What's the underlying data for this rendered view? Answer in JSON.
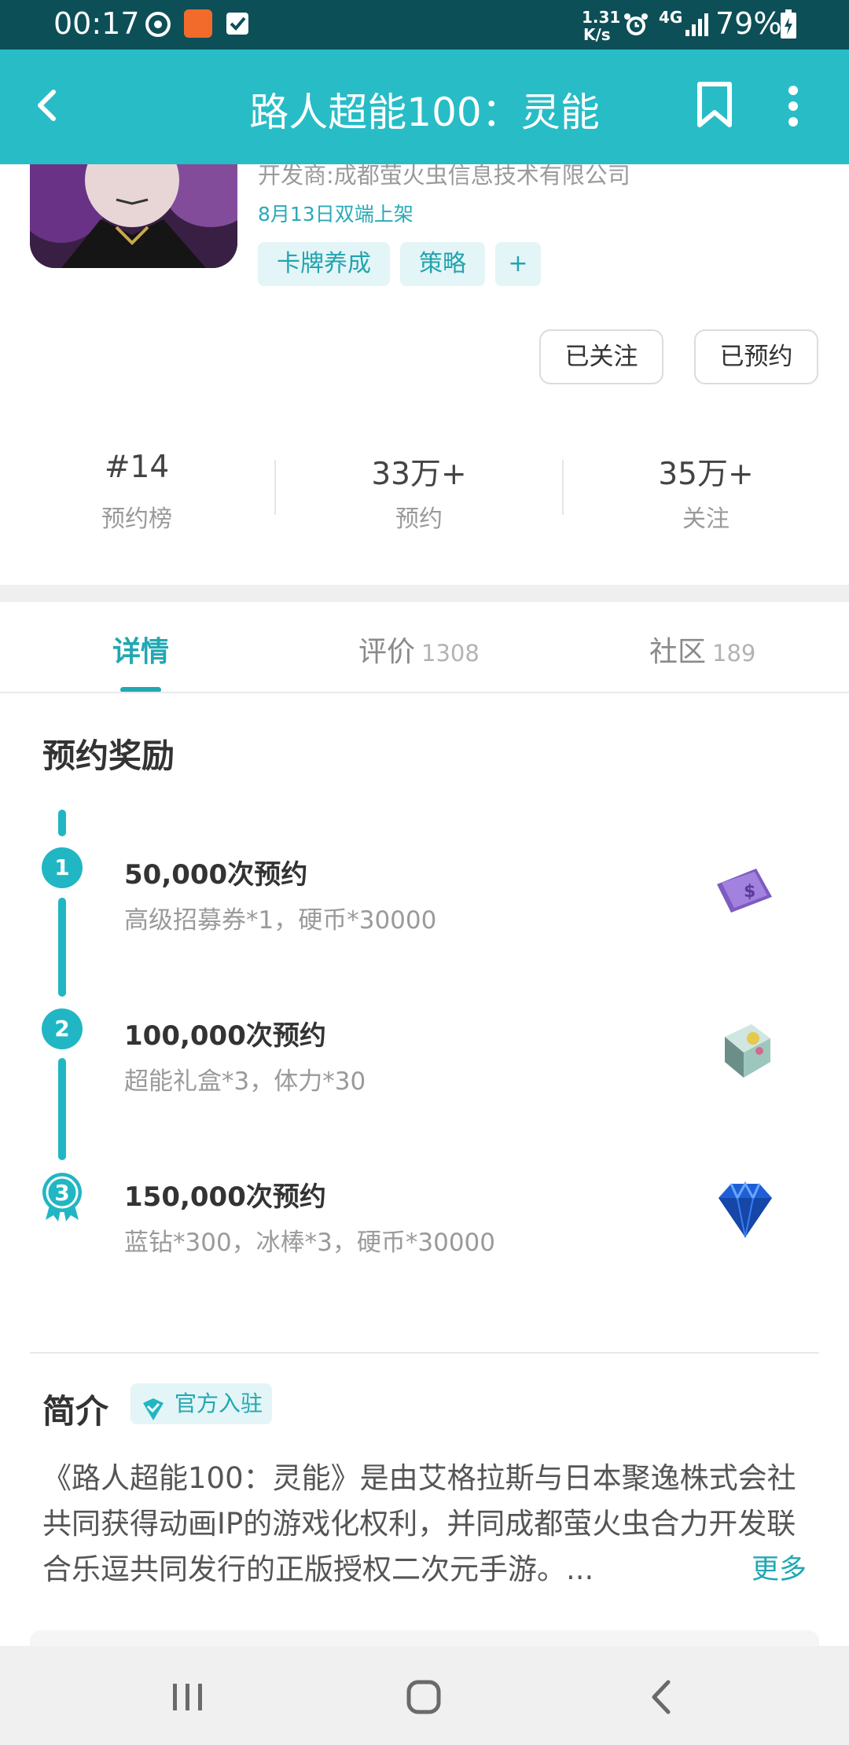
{
  "status_bar": {
    "time": "00:17",
    "speed_top": "1.31",
    "speed_bottom": "K/s",
    "network": "4G",
    "battery": "79%",
    "icons": [
      "sync-icon",
      "app-notification-icon",
      "checkbox-icon",
      "alarm-icon",
      "signal-icon",
      "battery-icon"
    ]
  },
  "app_bar": {
    "title": "路人超能100：灵能",
    "icons": [
      "back-arrow-icon",
      "bookmark-icon",
      "more-vertical-icon"
    ]
  },
  "game": {
    "developer": "开发商:成都萤火虫信息技术有限公司",
    "release": "8月13日双端上架",
    "tags": [
      "卡牌养成",
      "策略",
      "+"
    ],
    "followed_label": "已关注",
    "reserved_label": "已预约"
  },
  "stats": [
    {
      "value": "#14",
      "label": "预约榜"
    },
    {
      "value": "33万+",
      "label": "预约"
    },
    {
      "value": "35万+",
      "label": "关注"
    }
  ],
  "tabs": [
    {
      "label": "详情",
      "count": "",
      "active": true
    },
    {
      "label": "评价",
      "count": "1308",
      "active": false
    },
    {
      "label": "社区",
      "count": "189",
      "active": false
    }
  ],
  "rewards": {
    "title": "预约奖励",
    "items": [
      {
        "step": "1",
        "title": "50,000次预约",
        "desc": "高级招募券*1，硬币*30000",
        "icon": "ticket-icon"
      },
      {
        "step": "2",
        "title": "100,000次预约",
        "desc": "超能礼盒*3，体力*30",
        "icon": "gift-box-icon"
      },
      {
        "step": "3",
        "title": "150,000次预约",
        "desc": "蓝钻*300，冰棒*3，硬币*30000",
        "icon": "blue-diamond-icon"
      }
    ]
  },
  "intro": {
    "title": "简介",
    "badge": "官方入驻",
    "text": "《路人超能100：灵能》是由艾格拉斯与日本聚逸株式会社共同获得动画IP的游戏化权利，并同成都萤火虫合力开发联合乐逗共同发行的正版授权二次元手游。...",
    "more": "更多"
  },
  "nav_bar": {
    "icons": [
      "recent-apps-icon",
      "home-icon",
      "back-icon"
    ]
  },
  "colors": {
    "status_bar_bg": "#0d4f57",
    "app_bar_bg": "#28bcc6",
    "accent": "#21a8b3",
    "tag_bg": "#e3f5f6"
  }
}
